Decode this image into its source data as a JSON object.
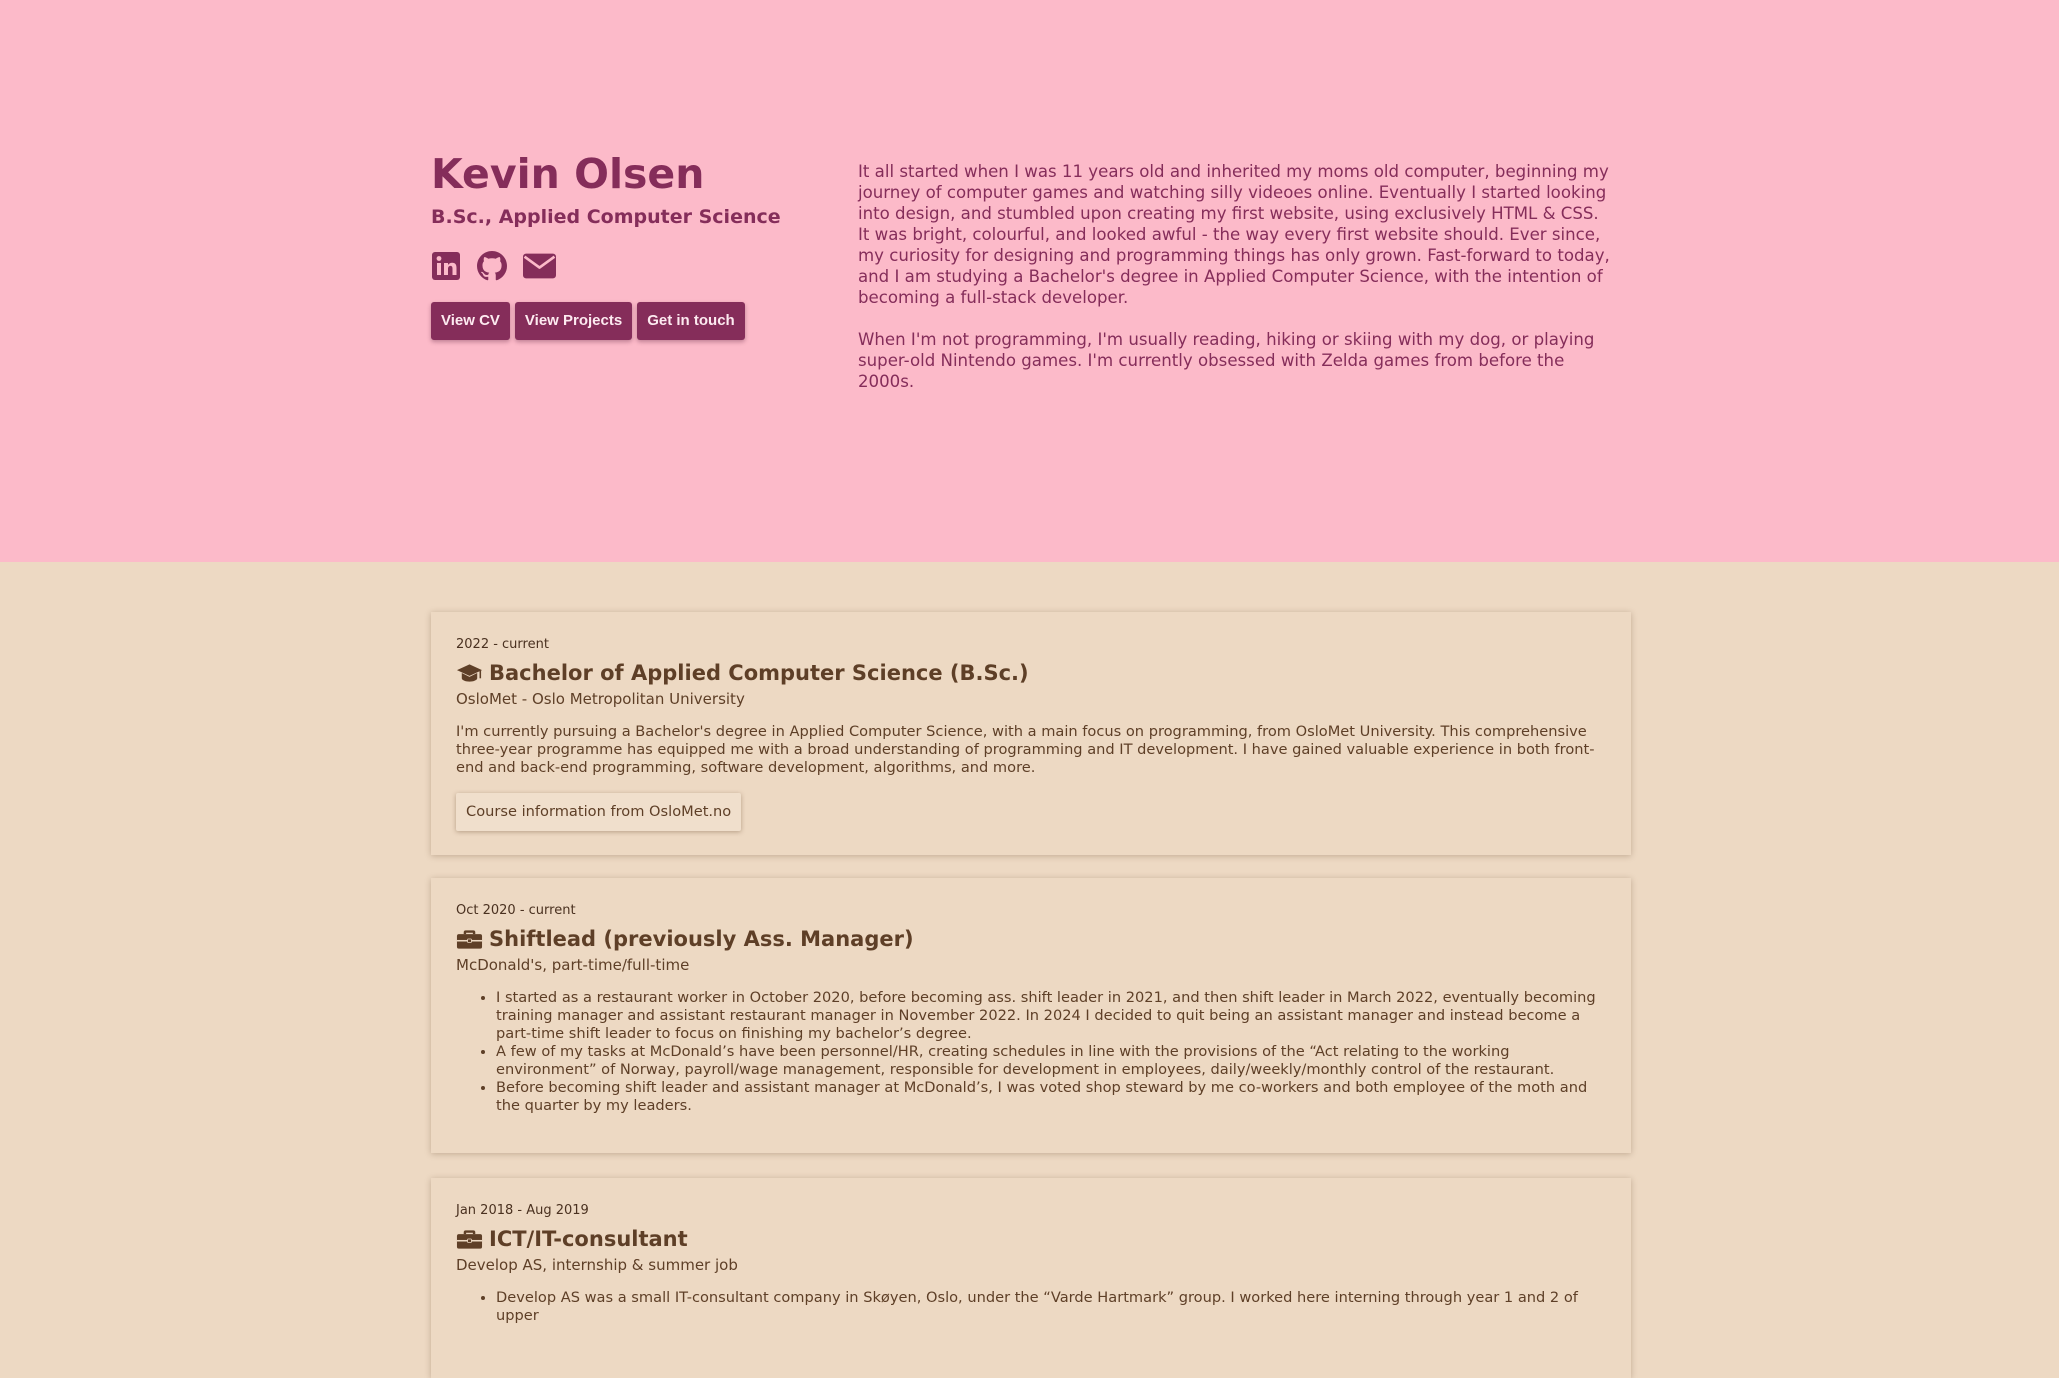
{
  "profile": {
    "name": "Kevin Olsen",
    "degree": "B.Sc., Applied Computer Science",
    "social_icons": [
      "linkedin-icon",
      "github-icon",
      "envelope-icon"
    ],
    "buttons": {
      "cv": "View CV",
      "projects": "View Projects",
      "contact": "Get in touch"
    }
  },
  "about": {
    "paragraph_1": "It all started when I was 11 years old and inherited my moms old computer, beginning my journey of computer games and watching silly videoes online. Eventually I started looking into design, and stumbled upon creating my first website, using exclusively HTML & CSS. It was bright, colourful, and looked awful - the way every first website should. Ever since, my curiosity for designing and programming things has only grown. Fast-forward to today, and I am studying a Bachelor's degree in Applied Computer Science, with the intention of becoming a full-stack developer.",
    "paragraph_2": "When I'm not programming, I'm usually reading, hiking or skiing with my dog, or playing super-old Nintendo games. I'm currently obsessed with Zelda games from before the 2000s."
  },
  "entries": [
    {
      "date": "2022 - current",
      "icon": "graduation-cap-icon",
      "title": "Bachelor of Applied Computer Science (B.Sc.)",
      "org": "OsloMet - Oslo Metropolitan University",
      "description": "I'm currently pursuing a Bachelor's degree in Applied Computer Science, with a main focus on programming, from OsloMet University. This comprehensive three-year programme has equipped me with a broad understanding of programming and IT development. I have gained valuable experience in both front-end and back-end programming, software development, algorithms, and more.",
      "link_label": "Course information from OsloMet.no"
    },
    {
      "date": "Oct 2020 - current",
      "icon": "briefcase-icon",
      "title": "Shiftlead (previously Ass. Manager)",
      "org": "McDonald's, part-time/full-time",
      "bullets": [
        "I started as a restaurant worker in October 2020, before becoming ass. shift leader in 2021, and then shift leader in March 2022, eventually becoming training manager and assistant restaurant manager in November 2022. In 2024 I decided to quit being an assistant manager and instead become a part-time shift leader to focus on finishing my bachelor’s degree.",
        "A few of my tasks at McDonald’s have been personnel/HR, creating schedules in line with the provisions of the “Act relating to the working environment” of Norway, payroll/wage management, responsible for development in employees, daily/weekly/monthly control of the restaurant.",
        "Before becoming shift leader and assistant manager at McDonald’s, I was voted shop steward by me co-workers and both employee of the moth and the quarter by my leaders."
      ]
    },
    {
      "date": "Jan 2018 - Aug 2019",
      "icon": "briefcase-icon",
      "title": "ICT/IT-consultant",
      "org": "Develop AS, internship & summer job",
      "bullets": [
        "Develop AS was a small IT-consultant company in Skøyen, Oslo, under the “Varde Hartmark” group. I worked here interning through year 1 and 2 of upper"
      ]
    }
  ],
  "colors": {
    "hero_bg": "#fcbac9",
    "accent": "#852d5a",
    "page_bg": "#edd9c3",
    "card_text": "#5e3f27"
  }
}
